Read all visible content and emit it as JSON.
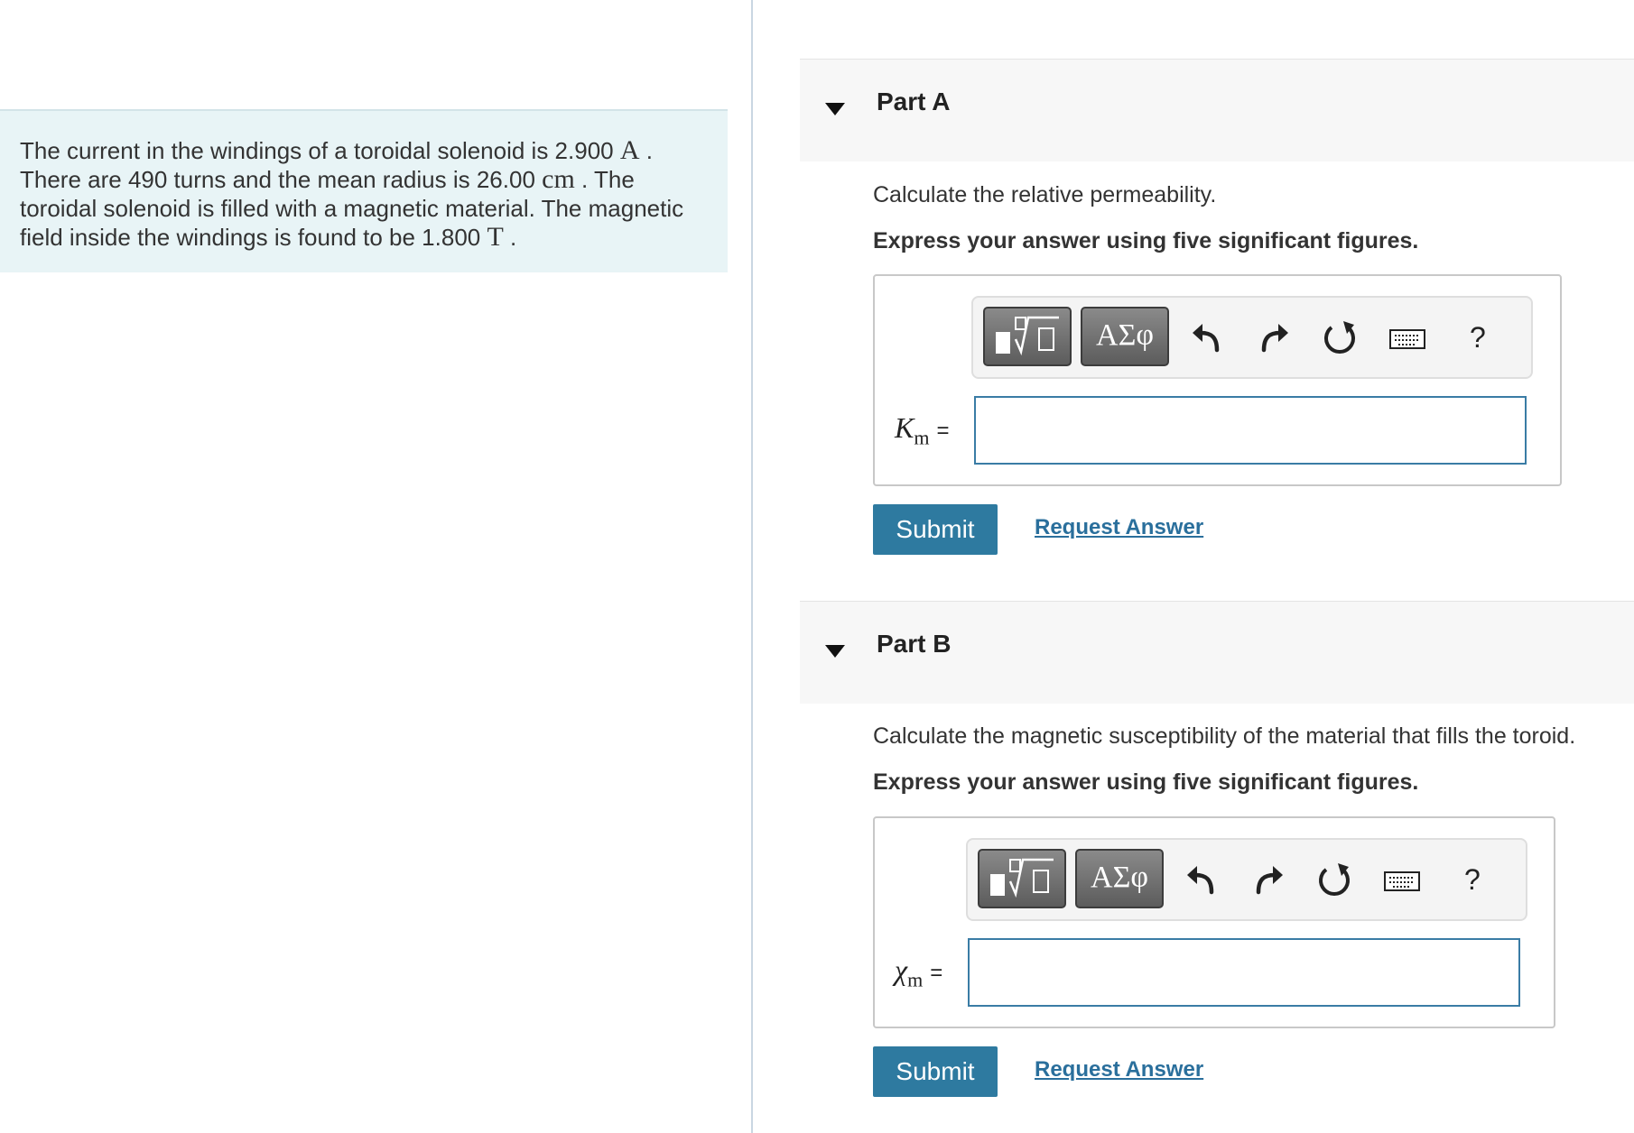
{
  "problem": {
    "t1": "The current in the windings of a toroidal solenoid is 2.900 ",
    "u1": "A",
    "t2": " .",
    "t3": "There are 490 turns and the mean radius is 26.00 ",
    "u2": "cm",
    "t4": " . The",
    "t5": "toroidal solenoid is filled with a magnetic material. The magnetic",
    "t6": "field inside the windings is found to be 1.800 ",
    "u3": "T",
    "t7": " ."
  },
  "toolbar": {
    "greek_label": "ΑΣφ",
    "help_label": "?",
    "icons": [
      "templates-icon",
      "undo-icon",
      "redo-icon",
      "reset-icon",
      "keyboard-icon",
      "help-icon"
    ]
  },
  "parts": [
    {
      "title": "Part A",
      "question": "Calculate the relative permeability.",
      "instruction": "Express your answer using five significant figures.",
      "var_symbol": "K",
      "var_sub": "m",
      "eq": "=",
      "input_value": "",
      "submit_label": "Submit",
      "request_label": "Request Answer"
    },
    {
      "title": "Part B",
      "question": "Calculate the magnetic susceptibility of the material that fills the toroid.",
      "instruction": "Express your answer using five significant figures.",
      "var_symbol": "χ",
      "var_sub": "m",
      "eq": "=",
      "input_value": "",
      "submit_label": "Submit",
      "request_label": "Request Answer"
    }
  ],
  "colors": {
    "accent": "#2e7aa0",
    "link": "#2a6f9c",
    "problem_bg": "#e8f4f6",
    "input_border": "#3a7ca5"
  }
}
